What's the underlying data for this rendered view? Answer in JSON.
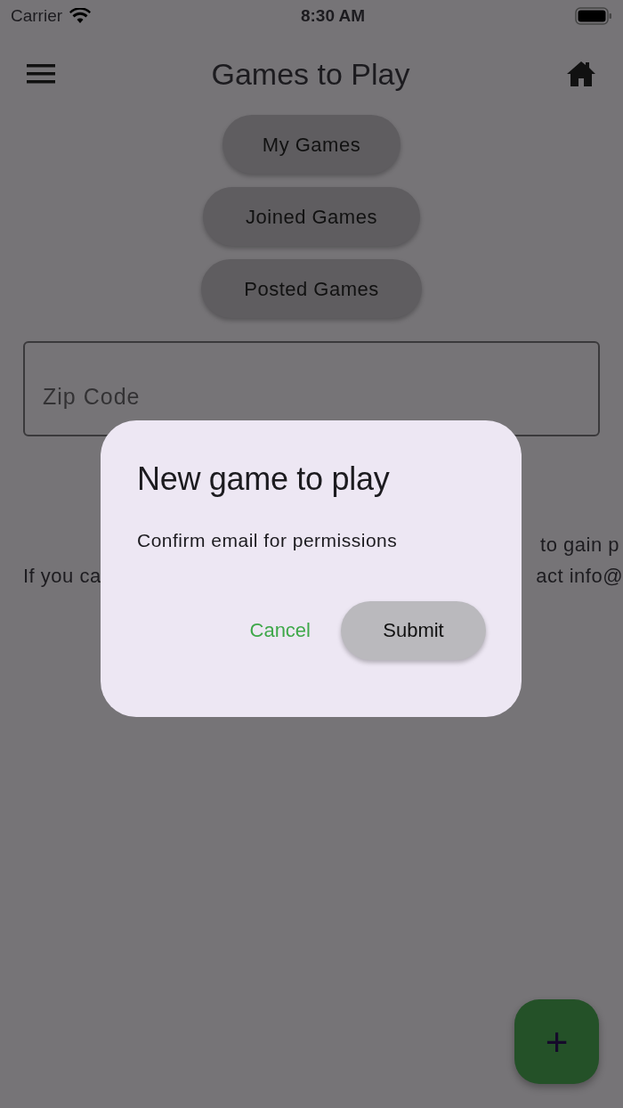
{
  "status_bar": {
    "carrier": "Carrier",
    "time": "8:30 AM"
  },
  "app_bar": {
    "title": "Games to Play"
  },
  "filter_buttons": [
    {
      "label": "My Games"
    },
    {
      "label": "Joined Games"
    },
    {
      "label": "Posted Games"
    }
  ],
  "zip_field": {
    "placeholder": "Zip Code"
  },
  "background_text": {
    "line_1_right": "to gain p",
    "line_2_left": "If you ca",
    "line_2_right": "act info@"
  },
  "dialog": {
    "title": "New game to play",
    "message": "Confirm email for permissions",
    "buttons": [
      {
        "label": "Cancel",
        "kind": "text"
      },
      {
        "label": "Submit",
        "kind": "filled"
      }
    ]
  },
  "fab": {
    "label": "+"
  }
}
